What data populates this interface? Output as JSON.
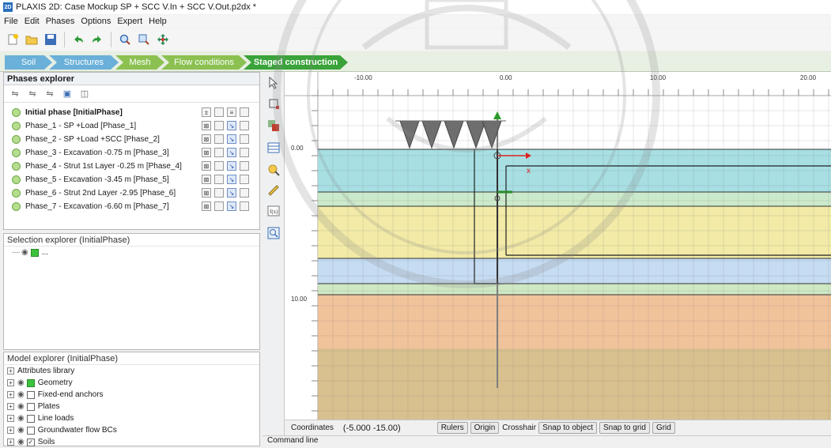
{
  "window": {
    "title": "PLAXIS 2D: Case Mockup SP + SCC V.In + SCC V.Out.p2dx *",
    "app_badge": "2D"
  },
  "menu": [
    "File",
    "Edit",
    "Phases",
    "Options",
    "Expert",
    "Help"
  ],
  "toolbar_icons": [
    "new-project-icon",
    "open-project-icon",
    "save-project-icon",
    "undo-icon",
    "redo-icon",
    "zoom-icon",
    "zoom-window-icon",
    "move-icon"
  ],
  "modes": [
    {
      "label": "Soil",
      "color": "#6ab0d8"
    },
    {
      "label": "Structures",
      "color": "#6ab0d8"
    },
    {
      "label": "Mesh",
      "color": "#8cc152"
    },
    {
      "label": "Flow conditions",
      "color": "#8cc152"
    },
    {
      "label": "Staged construction",
      "color": "#3aa33a"
    }
  ],
  "phases_explorer": {
    "title": "Phases explorer",
    "phases": [
      {
        "label": "Initial phase [InitialPhase]",
        "bold": true
      },
      {
        "label": "Phase_1 - SP +Load [Phase_1]",
        "bold": false
      },
      {
        "label": "Phase_2 - SP +Load +SCC [Phase_2]",
        "bold": false
      },
      {
        "label": "Phase_3 - Excavation -0.75 m [Phase_3]",
        "bold": false
      },
      {
        "label": "Phase_4 - Strut 1st Layer -0.25 m [Phase_4]",
        "bold": false
      },
      {
        "label": "Phase_5 - Excavation -3.45 m [Phase_5]",
        "bold": false
      },
      {
        "label": "Phase_6 - Strut 2nd Layer -2.95 [Phase_6]",
        "bold": false
      },
      {
        "label": "Phase_7 - Excavation -6.60 m [Phase_7]",
        "bold": false
      }
    ]
  },
  "selection_explorer": {
    "title": "Selection explorer (InitialPhase)",
    "item": "..."
  },
  "model_explorer": {
    "title": "Model explorer (InitialPhase)",
    "items": [
      {
        "label": "Attributes library",
        "checkbox": "none"
      },
      {
        "label": "Geometry",
        "checkbox": "green"
      },
      {
        "label": "Fixed-end anchors",
        "checkbox": "empty"
      },
      {
        "label": "Plates",
        "checkbox": "empty"
      },
      {
        "label": "Line loads",
        "checkbox": "empty"
      },
      {
        "label": "Groundwater flow BCs",
        "checkbox": "empty"
      },
      {
        "label": "Soils",
        "checkbox": "checked"
      }
    ]
  },
  "ruler": {
    "top_ticks": [
      "-10.00",
      "0.00",
      "10.00",
      "20.00"
    ],
    "left_ticks": [
      "0.00",
      "10.00"
    ]
  },
  "soil_layer_colors": [
    "#a7dfe3",
    "#cbeacb",
    "#f2eaa6",
    "#c5dcf2",
    "#cfe8c4",
    "#f1c39b",
    "#d9c08f"
  ],
  "status": {
    "coordinates_label": "Coordinates",
    "coordinates_value": "(-5.000 -15.00)",
    "buttons": [
      "Rulers",
      "Origin",
      "Crosshair",
      "Snap to object",
      "Snap to grid",
      "Grid"
    ]
  },
  "command_line": "Command line"
}
